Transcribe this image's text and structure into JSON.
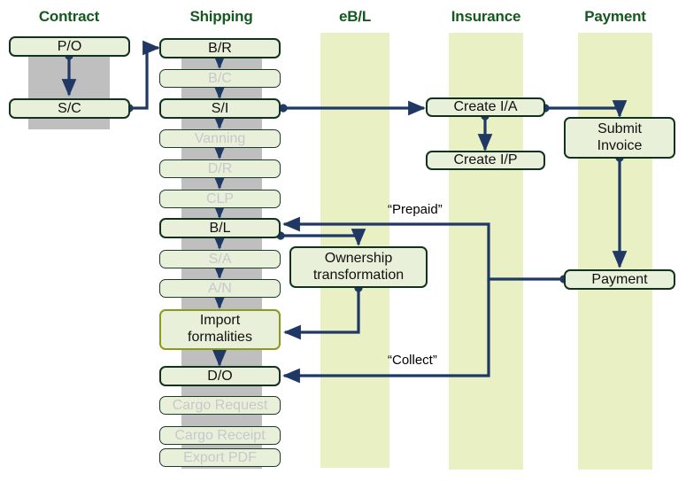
{
  "diagram": {
    "title": "Trade document flow swimlane diagram",
    "colors": {
      "header_text": "#14591d",
      "node_fill": "#e9f0d9",
      "node_border": "#12321f",
      "node_border_highlight": "#8a9a1e",
      "dim_text": "#c6c8ca",
      "arrow": "#1f3864",
      "band_yellow": "#e9f0c3",
      "band_gray": "#bfbfbf"
    },
    "columns": [
      {
        "id": "contract",
        "label": "Contract",
        "band": "gray"
      },
      {
        "id": "shipping",
        "label": "Shipping",
        "band": "gray"
      },
      {
        "id": "ebl",
        "label": "eB/L",
        "band": "yellow"
      },
      {
        "id": "insurance",
        "label": "Insurance",
        "band": "yellow"
      },
      {
        "id": "payment",
        "label": "Payment",
        "band": "yellow"
      }
    ],
    "nodes": [
      {
        "id": "po",
        "label": "P/O",
        "column": "contract",
        "state": "active"
      },
      {
        "id": "sc",
        "label": "S/C",
        "column": "contract",
        "state": "active"
      },
      {
        "id": "br",
        "label": "B/R",
        "column": "shipping",
        "state": "active"
      },
      {
        "id": "bc",
        "label": "B/C",
        "column": "shipping",
        "state": "dim"
      },
      {
        "id": "si",
        "label": "S/I",
        "column": "shipping",
        "state": "active"
      },
      {
        "id": "vanning",
        "label": "Vanning",
        "column": "shipping",
        "state": "dim"
      },
      {
        "id": "dr",
        "label": "D/R",
        "column": "shipping",
        "state": "dim"
      },
      {
        "id": "clp",
        "label": "CLP",
        "column": "shipping",
        "state": "dim"
      },
      {
        "id": "bl",
        "label": "B/L",
        "column": "shipping",
        "state": "active"
      },
      {
        "id": "sa",
        "label": "S/A",
        "column": "shipping",
        "state": "dim"
      },
      {
        "id": "an",
        "label": "A/N",
        "column": "shipping",
        "state": "dim"
      },
      {
        "id": "import",
        "label": "Import\nformalities",
        "column": "shipping",
        "state": "highlight"
      },
      {
        "id": "do",
        "label": "D/O",
        "column": "shipping",
        "state": "active"
      },
      {
        "id": "cargorequest",
        "label": "Cargo Request",
        "column": "shipping",
        "state": "dim"
      },
      {
        "id": "cargoreceipt",
        "label": "Cargo Receipt",
        "column": "shipping",
        "state": "dim"
      },
      {
        "id": "exportpdf",
        "label": "Export PDF",
        "column": "shipping",
        "state": "dim"
      },
      {
        "id": "ownership",
        "label": "Ownership\ntransformation",
        "column": "ebl",
        "state": "active"
      },
      {
        "id": "createia",
        "label": "Create I/A",
        "column": "insurance",
        "state": "active"
      },
      {
        "id": "createip",
        "label": "Create I/P",
        "column": "insurance",
        "state": "active"
      },
      {
        "id": "submitinvoice",
        "label": "Submit\nInvoice",
        "column": "payment",
        "state": "active"
      },
      {
        "id": "paymentnode",
        "label": "Payment",
        "column": "payment",
        "state": "active"
      }
    ],
    "edge_labels": [
      {
        "id": "prepaid",
        "text": "“Prepaid”"
      },
      {
        "id": "collect",
        "text": "“Collect”"
      }
    ],
    "edges": [
      {
        "from": "po",
        "to": "sc"
      },
      {
        "from": "sc",
        "to": "br"
      },
      {
        "from": "br",
        "to": "bc"
      },
      {
        "from": "bc",
        "to": "si"
      },
      {
        "from": "si",
        "to": "vanning"
      },
      {
        "from": "vanning",
        "to": "dr"
      },
      {
        "from": "dr",
        "to": "clp"
      },
      {
        "from": "clp",
        "to": "bl"
      },
      {
        "from": "bl",
        "to": "sa"
      },
      {
        "from": "sa",
        "to": "an"
      },
      {
        "from": "an",
        "to": "import"
      },
      {
        "from": "import",
        "to": "do"
      },
      {
        "from": "si",
        "to": "createia"
      },
      {
        "from": "createia",
        "to": "createip"
      },
      {
        "from": "createia",
        "to": "submitinvoice"
      },
      {
        "from": "submitinvoice",
        "to": "paymentnode"
      },
      {
        "from": "bl",
        "to": "ownership"
      },
      {
        "from": "ownership",
        "to": "import"
      },
      {
        "from": "paymentnode",
        "to": "bl",
        "label": "prepaid"
      },
      {
        "from": "paymentnode",
        "to": "do",
        "label": "collect"
      }
    ]
  }
}
